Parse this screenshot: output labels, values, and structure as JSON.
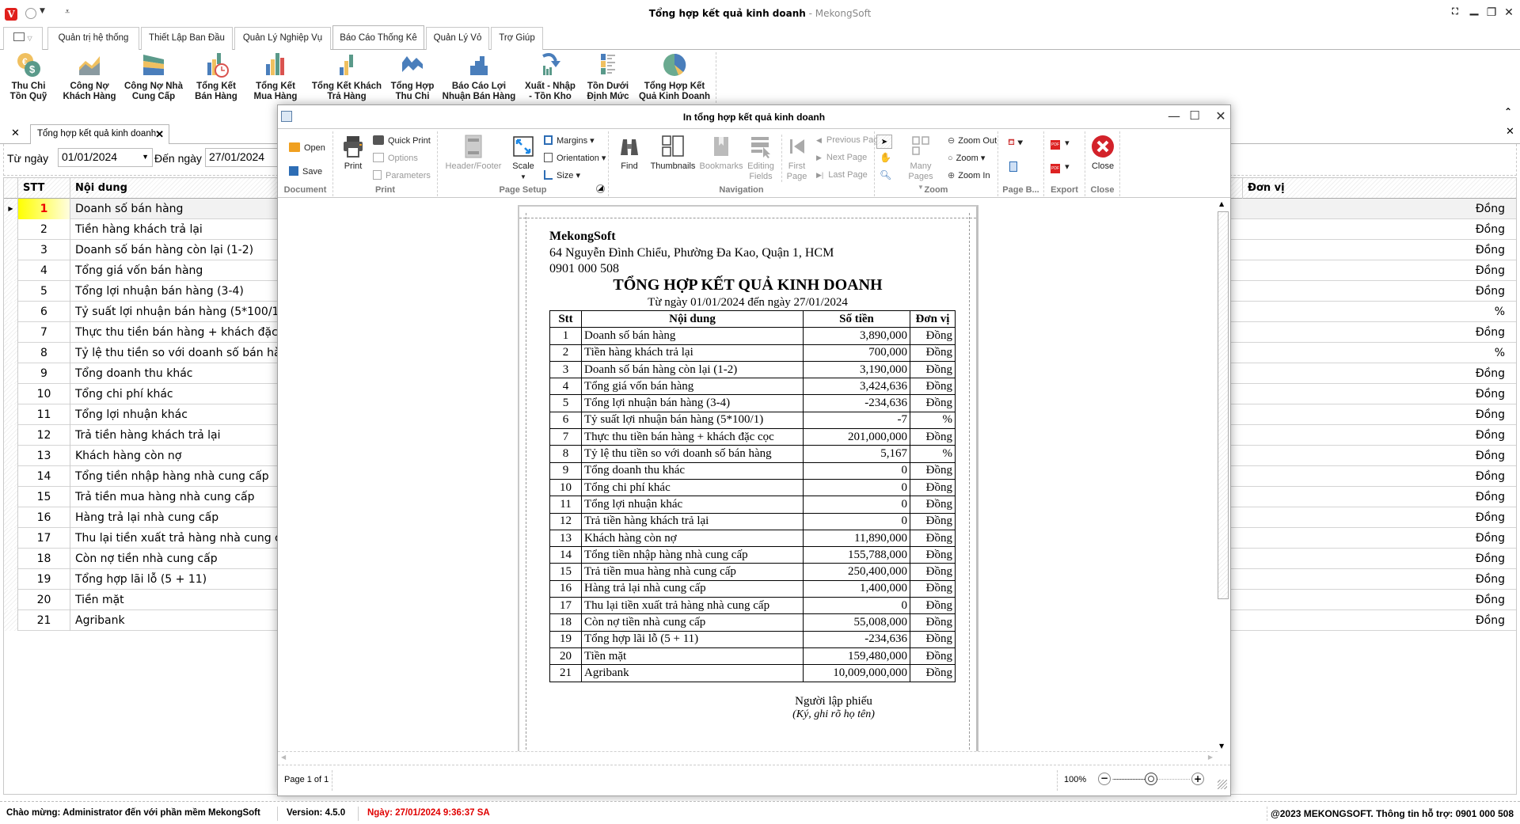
{
  "window": {
    "title": "Tổng hợp kết quả kinh doanh",
    "app_name": " - MekongSoft",
    "logo_letter": "V",
    "controls": {
      "fullscreen": "⛶",
      "minimize": "▁",
      "restore": "❐",
      "close": "✕"
    }
  },
  "ribbon": {
    "tabs": [
      {
        "label": "Quản trị hệ thống"
      },
      {
        "label": "Thiết Lập Ban Đầu"
      },
      {
        "label": "Quản Lý Nghiệp Vụ"
      },
      {
        "label": "Báo Cáo Thống Kê",
        "active": true
      },
      {
        "label": "Quản Lý Vỏ"
      },
      {
        "label": "Trợ Giúp"
      }
    ],
    "buttons": [
      {
        "line1": "Thu Chi",
        "line2": "Tồn Quỹ",
        "icon": "money-coins-icon"
      },
      {
        "line1": "Công Nợ",
        "line2": "Khách Hàng",
        "icon": "area-chart-icon"
      },
      {
        "line1": "Công Nợ Nhà",
        "line2": "Cung Cấp",
        "icon": "stacked-area-icon"
      },
      {
        "line1": "Tổng Kết",
        "line2": "Bán Hàng",
        "icon": "bar-clock-icon"
      },
      {
        "line1": "Tổng Kết",
        "line2": "Mua Hàng",
        "icon": "bar-chart-icon"
      },
      {
        "line1": "Tổng Kết Khách",
        "line2": "Trả Hàng",
        "icon": "step-bar-icon"
      },
      {
        "line1": "Tổng Hợp",
        "line2": "Thu Chi",
        "icon": "mountain-chart-icon"
      },
      {
        "line1": "Báo Cáo Lợi",
        "line2": "Nhuận Bán Hàng",
        "icon": "step-area-icon"
      },
      {
        "line1": "Xuất - Nhập",
        "line2": "- Tồn Kho",
        "icon": "bar-arrow-icon"
      },
      {
        "line1": "Tồn Dưới",
        "line2": "Định Mức",
        "icon": "list-bars-icon"
      },
      {
        "line1": "Tổng Hợp Kết",
        "line2": "Quả Kinh Doanh",
        "icon": "pie-chart-icon"
      }
    ]
  },
  "doc_tab": {
    "label": "Tổng hợp kết quả kinh doanh"
  },
  "filter": {
    "from_label": "Từ ngày",
    "from_value": "01/01/2024",
    "to_label": "Đến ngày",
    "to_value": "27/01/2024"
  },
  "grid": {
    "columns": {
      "stt": "STT",
      "noi_dung": "Nội dung",
      "don_vi": "Đơn vị"
    },
    "rows": [
      {
        "stt": "1",
        "noi_dung": "Doanh số bán hàng",
        "don_vi": "Đồng"
      },
      {
        "stt": "2",
        "noi_dung": "Tiền hàng khách trả lại",
        "don_vi": "Đồng"
      },
      {
        "stt": "3",
        "noi_dung": "Doanh số bán hàng còn lại (1-2)",
        "don_vi": "Đồng"
      },
      {
        "stt": "4",
        "noi_dung": "Tổng giá vốn bán hàng",
        "don_vi": "Đồng"
      },
      {
        "stt": "5",
        "noi_dung": "Tổng lợi nhuận bán hàng (3-4)",
        "don_vi": "Đồng"
      },
      {
        "stt": "6",
        "noi_dung": "Tỷ suất lợi nhuận bán hàng (5*100/1)",
        "don_vi": "%"
      },
      {
        "stt": "7",
        "noi_dung": "Thực thu tiền bán hàng + khách đặc cọc",
        "don_vi": "Đồng"
      },
      {
        "stt": "8",
        "noi_dung": "Tỷ lệ thu tiền so với doanh số bán hàng",
        "don_vi": "%"
      },
      {
        "stt": "9",
        "noi_dung": "Tổng doanh thu khác",
        "don_vi": "Đồng"
      },
      {
        "stt": "10",
        "noi_dung": "Tổng chi phí khác",
        "don_vi": "Đồng"
      },
      {
        "stt": "11",
        "noi_dung": "Tổng lợi nhuận khác",
        "don_vi": "Đồng"
      },
      {
        "stt": "12",
        "noi_dung": "Trả tiền hàng khách trả lại",
        "don_vi": "Đồng"
      },
      {
        "stt": "13",
        "noi_dung": "Khách hàng còn nợ",
        "don_vi": "Đồng"
      },
      {
        "stt": "14",
        "noi_dung": "Tổng tiền nhập hàng nhà cung cấp",
        "don_vi": "Đồng"
      },
      {
        "stt": "15",
        "noi_dung": "Trả tiền mua hàng nhà cung cấp",
        "don_vi": "Đồng"
      },
      {
        "stt": "16",
        "noi_dung": "Hàng trả lại nhà cung cấp",
        "don_vi": "Đồng"
      },
      {
        "stt": "17",
        "noi_dung": "Thu lại tiền xuất trả hàng nhà cung cấp",
        "don_vi": "Đồng"
      },
      {
        "stt": "18",
        "noi_dung": "Còn nợ tiền nhà cung cấp",
        "don_vi": "Đồng"
      },
      {
        "stt": "19",
        "noi_dung": "Tổng hợp lãi lỗ  (5 + 11)",
        "don_vi": "Đồng"
      },
      {
        "stt": "20",
        "noi_dung": "Tiền mặt",
        "don_vi": "Đồng"
      },
      {
        "stt": "21",
        "noi_dung": "Agribank",
        "don_vi": "Đồng"
      }
    ]
  },
  "preview": {
    "title": "In tổng hợp kết quả kinh doanh",
    "groups": {
      "document": {
        "label": "Document",
        "open": "Open",
        "save": "Save"
      },
      "print": {
        "label": "Print",
        "print": "Print",
        "quick_print": "Quick Print",
        "options": "Options",
        "parameters": "Parameters"
      },
      "page_setup": {
        "label": "Page Setup",
        "header_footer": "Header/Footer",
        "scale": "Scale",
        "margins": "Margins",
        "orientation": "Orientation",
        "size": "Size"
      },
      "navigation": {
        "label": "Navigation",
        "find": "Find",
        "thumbnails": "Thumbnails",
        "bookmarks": "Bookmarks",
        "editing_fields_1": "Editing",
        "editing_fields_2": "Fields",
        "first_page_1": "First",
        "first_page_2": "Page",
        "previous_page": "Previous Page",
        "next_page": "Next  Page",
        "last_page": "Last  Page"
      },
      "zoom": {
        "label": "Zoom",
        "many_pages": "Many Pages",
        "zoom_out": "Zoom Out",
        "zoom": "Zoom",
        "zoom_in": "Zoom In"
      },
      "page_background": {
        "label": "Page B..."
      },
      "export": {
        "label": "Export"
      },
      "close": {
        "label": "Close",
        "close": "Close"
      }
    },
    "status": {
      "page_info": "Page 1 of 1",
      "zoom_level": "100%",
      "zoom_fraction": 0.5
    }
  },
  "report": {
    "company": "MekongSoft",
    "address": "64 Nguyễn Đình Chiểu, Phường Đa Kao, Quận 1, HCM",
    "phone": "0901 000 508",
    "title": "TỔNG HỢP KẾT QUẢ KINH DOANH",
    "range": "Từ ngày 01/01/2024 đến ngày 27/01/2024",
    "headers": {
      "stt": "Stt",
      "noi_dung": "Nội dung",
      "so_tien": "Số tiền",
      "don_vi": "Đơn vị"
    },
    "rows": [
      {
        "stt": "1",
        "noi_dung": "Doanh số bán hàng",
        "so_tien": "3,890,000",
        "don_vi": "Đồng"
      },
      {
        "stt": "2",
        "noi_dung": "Tiền hàng khách trả lại",
        "so_tien": "700,000",
        "don_vi": "Đồng"
      },
      {
        "stt": "3",
        "noi_dung": "Doanh số bán hàng còn lại (1-2)",
        "so_tien": "3,190,000",
        "don_vi": "Đồng"
      },
      {
        "stt": "4",
        "noi_dung": "Tổng giá vốn bán hàng",
        "so_tien": "3,424,636",
        "don_vi": "Đồng"
      },
      {
        "stt": "5",
        "noi_dung": "Tổng lợi nhuận bán hàng (3-4)",
        "so_tien": "-234,636",
        "don_vi": "Đồng"
      },
      {
        "stt": "6",
        "noi_dung": "Tỷ suất lợi nhuận bán hàng (5*100/1)",
        "so_tien": "-7",
        "don_vi": "%"
      },
      {
        "stt": "7",
        "noi_dung": "Thực thu tiền bán hàng + khách đặc cọc",
        "so_tien": "201,000,000",
        "don_vi": "Đồng"
      },
      {
        "stt": "8",
        "noi_dung": "Tỷ lệ thu tiền so với doanh số bán hàng",
        "so_tien": "5,167",
        "don_vi": "%"
      },
      {
        "stt": "9",
        "noi_dung": "Tổng doanh thu khác",
        "so_tien": "0",
        "don_vi": "Đồng"
      },
      {
        "stt": "10",
        "noi_dung": "Tổng chi phí khác",
        "so_tien": "0",
        "don_vi": "Đồng"
      },
      {
        "stt": "11",
        "noi_dung": "Tổng lợi nhuận khác",
        "so_tien": "0",
        "don_vi": "Đồng"
      },
      {
        "stt": "12",
        "noi_dung": "Trả tiền hàng khách trả lại",
        "so_tien": "0",
        "don_vi": "Đồng"
      },
      {
        "stt": "13",
        "noi_dung": "Khách hàng còn nợ",
        "so_tien": "11,890,000",
        "don_vi": "Đồng"
      },
      {
        "stt": "14",
        "noi_dung": "Tổng tiền nhập hàng nhà cung cấp",
        "so_tien": "155,788,000",
        "don_vi": "Đồng"
      },
      {
        "stt": "15",
        "noi_dung": "Trả tiền mua hàng nhà cung cấp",
        "so_tien": "250,400,000",
        "don_vi": "Đồng"
      },
      {
        "stt": "16",
        "noi_dung": "Hàng trả lại nhà cung cấp",
        "so_tien": "1,400,000",
        "don_vi": "Đồng"
      },
      {
        "stt": "17",
        "noi_dung": "Thu lại tiền xuất trả hàng nhà cung cấp",
        "so_tien": "0",
        "don_vi": "Đồng"
      },
      {
        "stt": "18",
        "noi_dung": "Còn nợ tiền nhà cung cấp",
        "so_tien": "55,008,000",
        "don_vi": "Đồng"
      },
      {
        "stt": "19",
        "noi_dung": "Tổng hợp lãi lỗ  (5 + 11)",
        "so_tien": "-234,636",
        "don_vi": "Đồng"
      },
      {
        "stt": "20",
        "noi_dung": "Tiền mặt",
        "so_tien": "159,480,000",
        "don_vi": "Đồng"
      },
      {
        "stt": "21",
        "noi_dung": "Agribank",
        "so_tien": "10,009,000,000",
        "don_vi": "Đồng"
      }
    ],
    "signer": "Người lập phiếu",
    "signer_note": "(Ký, ghi rõ họ tên)"
  },
  "statusbar": {
    "welcome": "Chào mừng: Administrator đến với phần mềm MekongSoft",
    "version": "Version: 4.5.0",
    "date": "Ngày: 27/01/2024 9:36:37 SA",
    "copyright": "@2023 MEKONGSOFT. Thông tin hỗ trợ: 0901 000 508"
  },
  "colors": {
    "accent_red": "#e0201c",
    "date_red": "#e00000",
    "selection_yellow": "#ffff00",
    "ribbon_blue": "#4a7ebb"
  }
}
